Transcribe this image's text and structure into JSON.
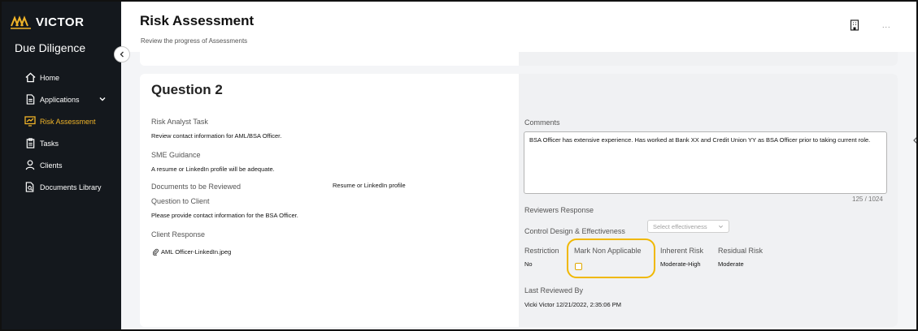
{
  "brand": {
    "logo_text": "VICTOR",
    "app_title": "Due Diligence",
    "accent": "#f0b429"
  },
  "sidebar": {
    "items": [
      {
        "label": "Home",
        "icon": "home-icon",
        "active": false
      },
      {
        "label": "Applications",
        "icon": "document-icon",
        "active": false,
        "expandable": true
      },
      {
        "label": "Risk Assessment",
        "icon": "risk-chart-icon",
        "active": true
      },
      {
        "label": "Tasks",
        "icon": "clipboard-icon",
        "active": false
      },
      {
        "label": "Clients",
        "icon": "user-icon",
        "active": false
      },
      {
        "label": "Documents Library",
        "icon": "document-search-icon",
        "active": false
      }
    ]
  },
  "header": {
    "title": "Risk Assessment",
    "subtitle": "Review the progress of Assessments",
    "more_label": "..."
  },
  "question": {
    "title": "Question 2",
    "risk_analyst_task_label": "Risk Analyst Task",
    "risk_analyst_task": "Review contact information for AML/BSA Officer.",
    "sme_guidance_label": "SME Guidance",
    "sme_guidance": "A resume or LinkedIn profile will be adequate.",
    "documents_label": "Documents to be Reviewed",
    "documents": "Resume or LinkedIn profile",
    "question_to_client_label": "Question to Client",
    "question_to_client": "Please provide contact information for the BSA Officer.",
    "client_response_label": "Client Response",
    "attachment": "AML Officer-LinkedIn.jpeg"
  },
  "review": {
    "comments_label": "Comments",
    "comments": "BSA Officer has extensive experience. Has worked at Bank XX and Credit Union YY as BSA Officer prior to taking current role.",
    "counter": "125 / 1024",
    "reviewers_response_label": "Reviewers Response",
    "control_design_label": "Control Design & Effectiveness",
    "effectiveness_placeholder": "Select effectiveness",
    "restriction_label": "Restriction",
    "restriction": "No",
    "mark_na_label": "Mark Non Applicable",
    "mark_na_checked": false,
    "inherent_risk_label": "Inherent Risk",
    "inherent_risk": "Moderate-High",
    "residual_risk_label": "Residual Risk",
    "residual_risk": "Moderate",
    "last_reviewed_label": "Last Reviewed By",
    "last_reviewed": "Vicki Victor 12/21/2022, 2:35:06 PM"
  }
}
